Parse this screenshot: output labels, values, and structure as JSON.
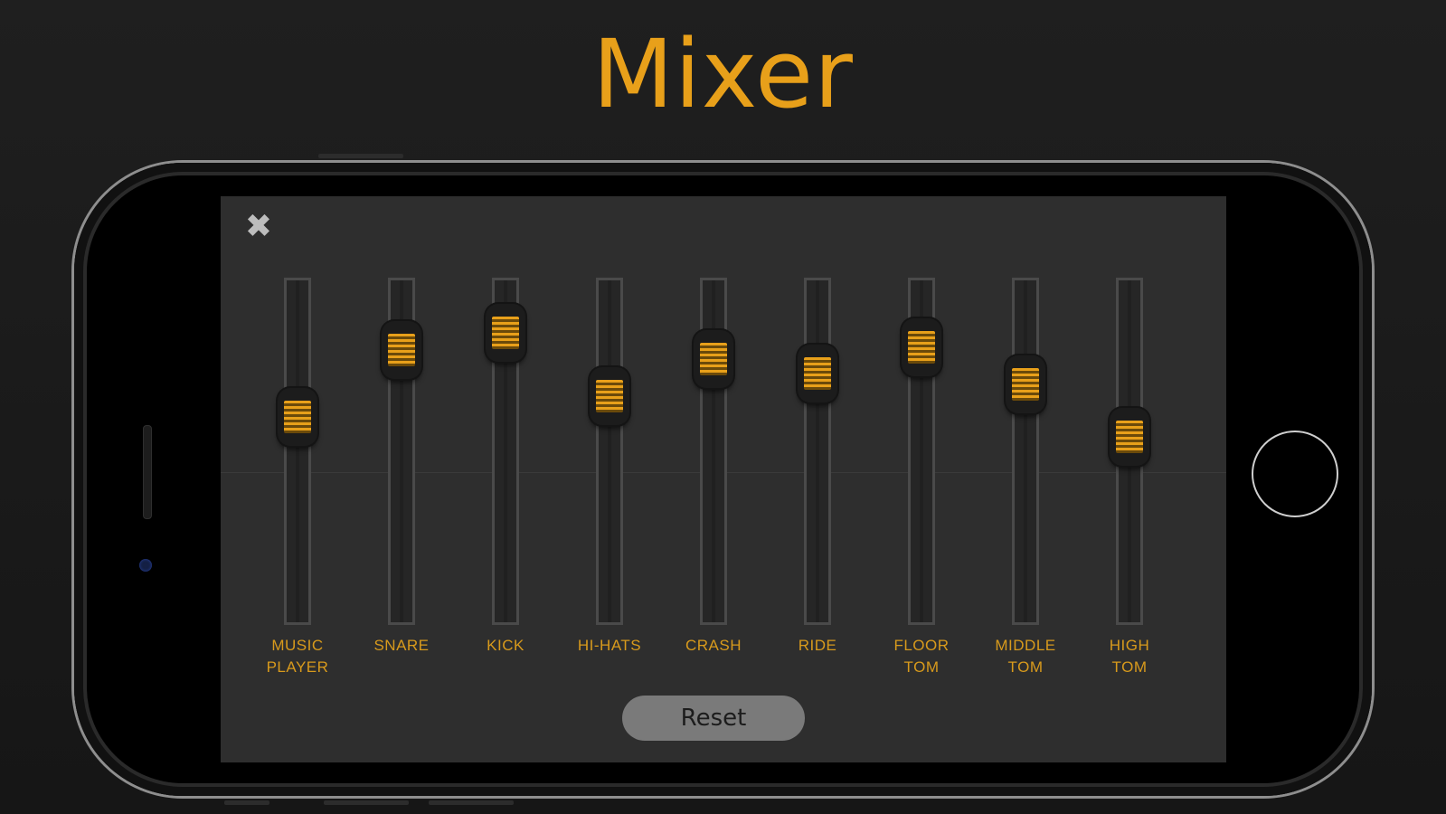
{
  "page": {
    "title": "Mixer"
  },
  "mixer": {
    "close_glyph": "✖",
    "reset_label": "Reset",
    "accent_color": "#e8a01a",
    "channels": [
      {
        "label": "MUSIC\nPLAYER",
        "level": 0.62
      },
      {
        "label": "SNARE",
        "level": 0.85
      },
      {
        "label": "KICK",
        "level": 0.91
      },
      {
        "label": "HI-HATS",
        "level": 0.69
      },
      {
        "label": "CRASH",
        "level": 0.82
      },
      {
        "label": "RIDE",
        "level": 0.77
      },
      {
        "label": "FLOOR\nTOM",
        "level": 0.86
      },
      {
        "label": "MIDDLE\nTOM",
        "level": 0.73
      },
      {
        "label": "HIGH\nTOM",
        "level": 0.55
      }
    ]
  }
}
